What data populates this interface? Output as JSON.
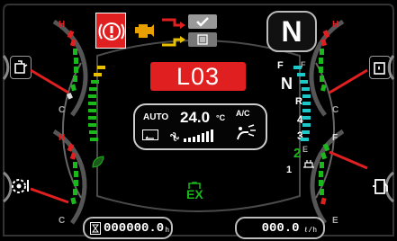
{
  "gauges": {
    "top_left": {
      "hot": "H",
      "cold": "C",
      "icon": "oil-can-icon"
    },
    "bottom_left": {
      "hot": "H",
      "cold": "C",
      "icon": "transmission-gear-temp-icon"
    },
    "top_right": {
      "hot": "H",
      "cold": "C",
      "icon": "hydraulic-oil-icon"
    },
    "bottom_right": {
      "full": "F",
      "empty": "E",
      "icon": "fuel-pump-icon"
    }
  },
  "warnings": {
    "active_icon": "brake-warning-icon",
    "secondary_icon": "engine-check-icon",
    "ok_icon": "checkmark-icon",
    "menu_icon": "list-icon"
  },
  "gear": {
    "current": "N"
  },
  "error_code": "L03",
  "shift_scale": {
    "f": "F",
    "n": "N",
    "r": "R",
    "gears": [
      "4",
      "3",
      "2",
      "1"
    ],
    "active_gear": "2"
  },
  "climate": {
    "mode": "AUTO",
    "temperature": "24.0",
    "unit": "°C",
    "ac": "A/C",
    "icons": [
      "recirculation-icon",
      "fan-icon",
      "airflow-icon"
    ],
    "fan_level": 5
  },
  "indicators": {
    "eco_icon": "leaf-icon",
    "ex_label": "EX"
  },
  "hour_meter": {
    "value": "000000.0",
    "unit": "h"
  },
  "fuel_rate": {
    "value": "000.0",
    "unit": "ℓ/h"
  },
  "colors": {
    "red": "#e02020",
    "green": "#1bb81b",
    "yellow": "#e8c000",
    "cyan": "#1ec8c8",
    "bezel": "#5a5a5a"
  }
}
